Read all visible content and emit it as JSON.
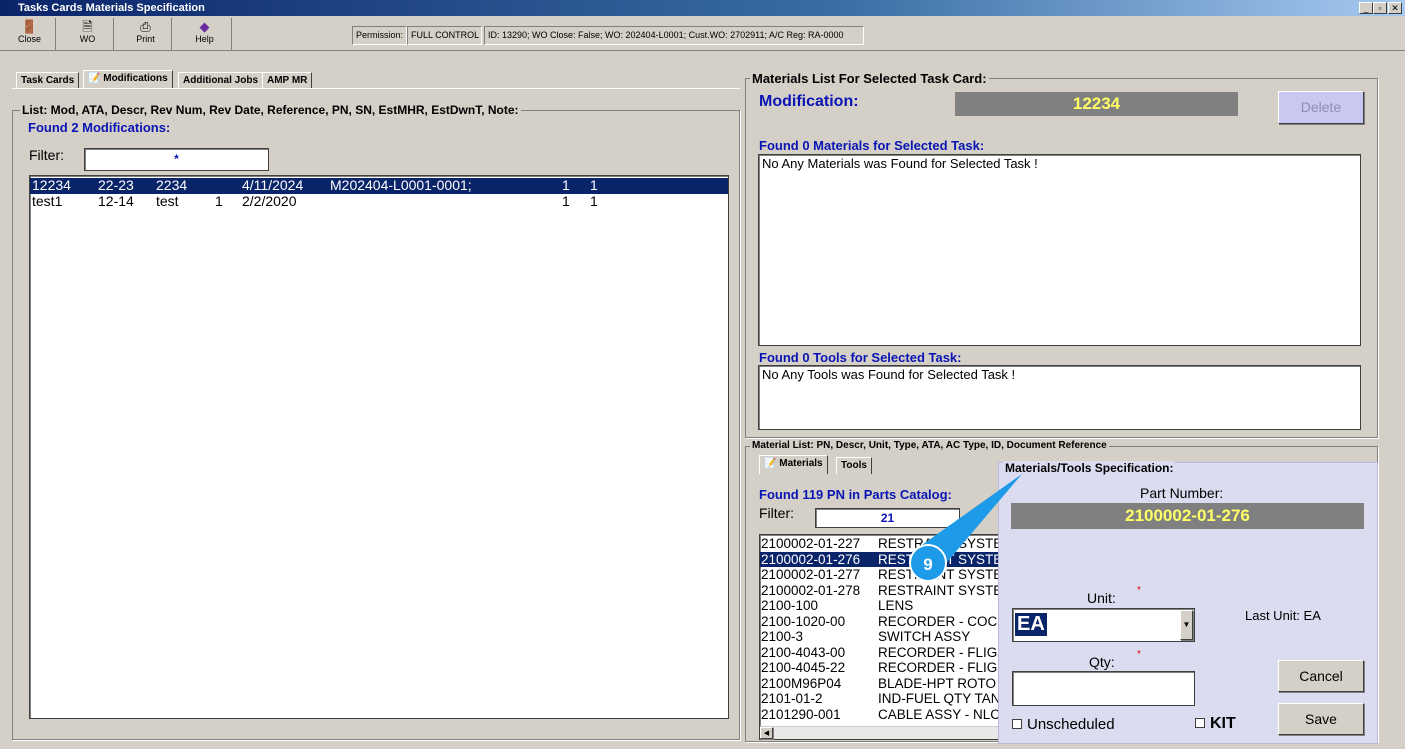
{
  "window": {
    "title": "Tasks Cards Materials Specification",
    "min": "_",
    "max": "▫",
    "close": "✕"
  },
  "toolbar": {
    "close": "Close",
    "wo": "WO",
    "print": "Print",
    "help": "Help"
  },
  "info": {
    "permission_label": "Permission:",
    "permission_value": "FULL CONTROL",
    "details": "ID: 13290; WO Close: False; WO: 202404-L0001; Cust.WO: 2702911; A/C Reg: RA-0000"
  },
  "tabs": [
    "Task Cards",
    "Modifications",
    "Additional Jobs",
    "AMP MR"
  ],
  "left": {
    "group_label": "List: Mod, ATA, Descr, Rev Num, Rev Date, Reference, PN, SN, EstMHR, EstDwnT, Note:",
    "found": "Found 2 Modifications:",
    "filter_label": "Filter:",
    "filter_value": "*",
    "rows": [
      [
        "12234",
        "22-23",
        "2234",
        "",
        "4/11/2024",
        "M202404-L0001-0001;",
        "1",
        "1"
      ],
      [
        "test1",
        "12-14",
        "test",
        "1",
        "2/2/2020",
        "",
        "1",
        "1"
      ]
    ]
  },
  "right": {
    "group_label": "Materials List For Selected Task Card:",
    "mod_label": "Modification:",
    "mod_value": "12234",
    "delete": "Delete",
    "materials_found": "Found 0 Materials for Selected Task:",
    "materials_empty": "No Any Materials was Found for Selected Task !",
    "tools_found": "Found 0 Tools for Selected Task:",
    "tools_empty": "No Any Tools was Found for Selected Task !"
  },
  "catalog": {
    "group_label": "Material List: PN, Descr, Unit, Type, ATA, AC Type, ID, Document Reference",
    "tabs": [
      "Materials",
      "Tools"
    ],
    "found": "Found 119 PN in Parts Catalog:",
    "filter_label": "Filter:",
    "filter_value": "21",
    "rows": [
      [
        "2100002-01-227",
        "RESTRAINT SYSTE"
      ],
      [
        "2100002-01-276",
        "RESTRAINT SYSTE"
      ],
      [
        "2100002-01-277",
        "RESTRAINT SYSTE"
      ],
      [
        "2100002-01-278",
        "RESTRAINT SYSTE"
      ],
      [
        "2100-100",
        "LENS"
      ],
      [
        "2100-1020-00",
        "RECORDER - COC"
      ],
      [
        "2100-3",
        "SWITCH ASSY"
      ],
      [
        "2100-4043-00",
        "RECORDER - FLIG"
      ],
      [
        "2100-4045-22",
        "RECORDER - FLIG"
      ],
      [
        "2100M96P04",
        "BLADE-HPT ROTO"
      ],
      [
        "2101-01-2",
        "IND-FUEL QTY TAN"
      ],
      [
        "2101290-001",
        "CABLE ASSY - NLC"
      ]
    ]
  },
  "spec": {
    "group_label": "Materials/Tools Specification:",
    "pn_label": "Part Number:",
    "pn_value": "2100002-01-276",
    "unit_label": "Unit:",
    "unit_value": "EA",
    "last_unit": "Last Unit: EA",
    "qty_label": "Qty:",
    "qty_value": "",
    "required": "*",
    "unscheduled": "Unscheduled",
    "kit": "KIT",
    "cancel": "Cancel",
    "save": "Save"
  },
  "callout": {
    "number": "9",
    "color": "#1e9be8"
  }
}
